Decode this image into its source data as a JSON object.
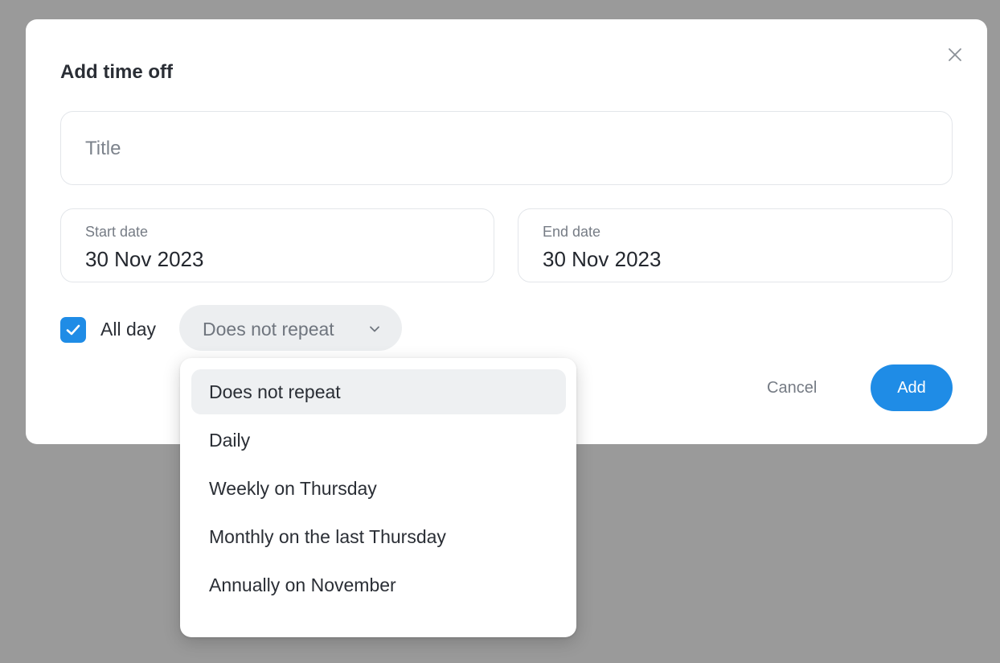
{
  "dialog": {
    "title": "Add time off",
    "close_icon": "close-icon"
  },
  "form": {
    "title_placeholder": "Title",
    "title_value": "",
    "start_date": {
      "label": "Start date",
      "value": "30 Nov 2023"
    },
    "end_date": {
      "label": "End date",
      "value": "30 Nov 2023"
    },
    "all_day": {
      "label": "All day",
      "checked": true,
      "icon": "checkmark-icon"
    },
    "repeat": {
      "selected": "Does not repeat",
      "icon": "chevron-down-icon"
    }
  },
  "actions": {
    "cancel_label": "Cancel",
    "add_label": "Add"
  },
  "repeat_menu": {
    "options": [
      "Does not repeat",
      "Daily",
      "Weekly on Thursday",
      "Monthly on the last Thursday",
      "Annually on November"
    ],
    "selected_index": 0
  },
  "colors": {
    "accent": "#1f8ce6",
    "backdrop": "#9a9a9a",
    "surface": "#ffffff"
  }
}
